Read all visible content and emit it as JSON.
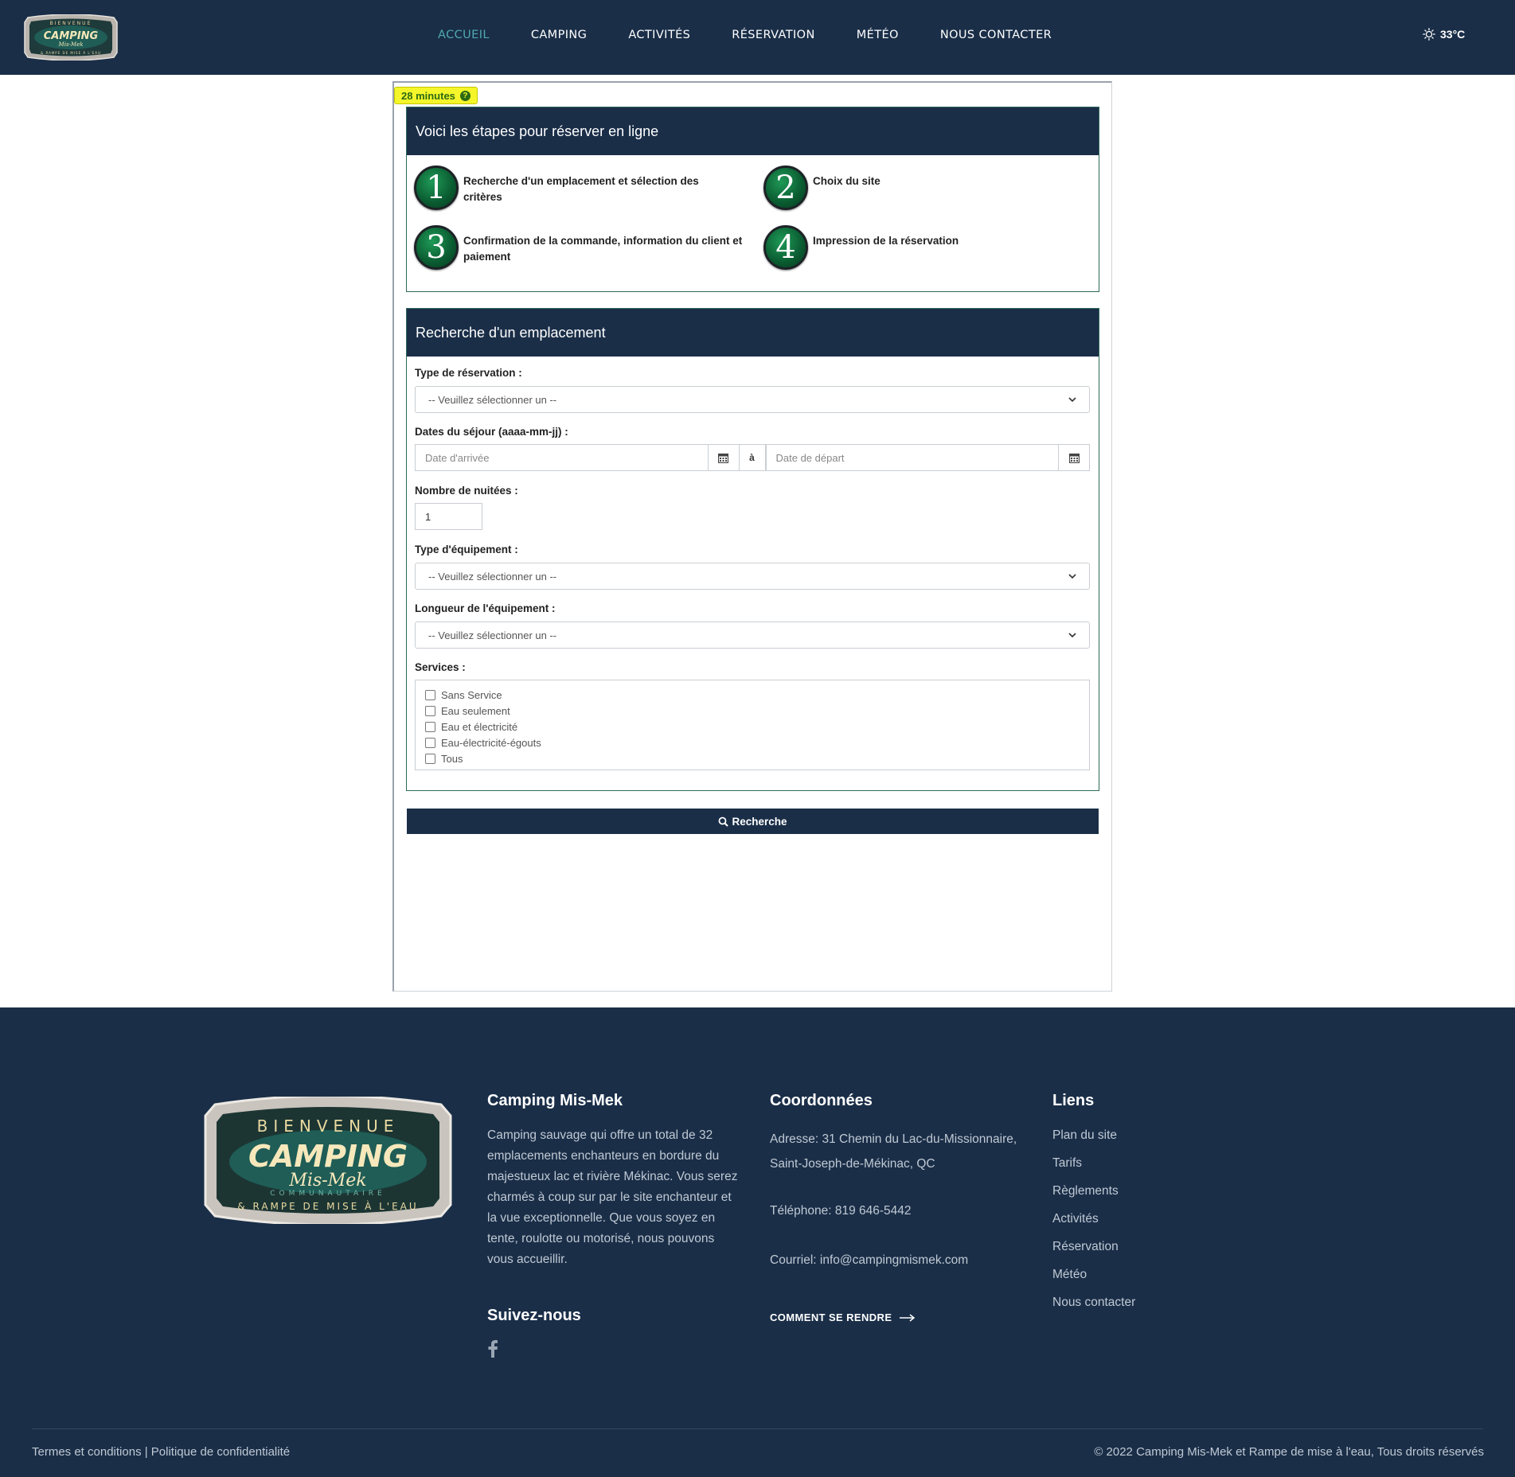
{
  "header": {
    "logo": {
      "top": "BIENVENUE",
      "main": "CAMPING",
      "script": "Mis-Mek",
      "sub": "& RAMPE DE MISE À L'EAU"
    },
    "nav": [
      "ACCUEIL",
      "CAMPING",
      "ACTIVITÉS",
      "RÉSERVATION",
      "MÉTÉO",
      "NOUS CONTACTER"
    ],
    "active_nav": "ACCUEIL",
    "weather": {
      "icon": "sun-icon",
      "temp": "33°C"
    }
  },
  "timer": {
    "label": "28 minutes",
    "icon": "question-circle-icon"
  },
  "steps_panel": {
    "title": "Voici les étapes pour réserver en ligne",
    "steps": [
      {
        "num": "1",
        "text": "Recherche d'un emplacement et sélection des critères"
      },
      {
        "num": "2",
        "text": "Choix du site"
      },
      {
        "num": "3",
        "text": "Confirmation de la commande, information du client et paiement"
      },
      {
        "num": "4",
        "text": "Impression de la réservation"
      }
    ]
  },
  "search_panel": {
    "title": "Recherche d'un emplacement",
    "type_reservation": {
      "label": "Type de réservation :",
      "value": "-- Veuillez sélectionner un --"
    },
    "dates": {
      "label": "Dates du séjour (aaaa-mm-jj) :",
      "arrival_placeholder": "Date d'arrivée",
      "separator": "à",
      "departure_placeholder": "Date de départ"
    },
    "nuitees": {
      "label": "Nombre de nuitées :",
      "value": "1"
    },
    "equipement": {
      "label": "Type d'équipement :",
      "value": "-- Veuillez sélectionner un --"
    },
    "longueur": {
      "label": "Longueur de l'équipement :",
      "value": "-- Veuillez sélectionner un --"
    },
    "services": {
      "label": "Services :",
      "options": [
        "Sans Service",
        "Eau seulement",
        "Eau et électricité",
        "Eau-électricité-égouts",
        "Tous"
      ]
    }
  },
  "search_button": {
    "label": "Recherche",
    "icon": "search-icon"
  },
  "footer": {
    "about": {
      "title": "Camping Mis-Mek",
      "text": "Camping sauvage qui offre un total de 32 emplacements enchanteurs en bordure du majestueux lac et rivière Mékinac. Vous serez charmés à coup sur par le site enchanteur et la vue exceptionnelle. Que vous soyez en tente, roulotte ou motorisé, nous pouvons vous accueillir."
    },
    "follow": {
      "title": "Suivez-nous",
      "icon": "facebook-icon"
    },
    "contact": {
      "title": "Coordonnées",
      "address": "Adresse: 31 Chemin du Lac-du-Missionnaire, Saint-Joseph-de-Mékinac, QC",
      "phone": "Téléphone: 819 646-5442",
      "email": "Courriel: info@campingmismek.com",
      "directions": "COMMENT SE RENDRE"
    },
    "links": {
      "title": "Liens",
      "items": [
        "Plan du site",
        "Tarifs",
        "Règlements",
        "Activités",
        "Réservation",
        "Météo",
        "Nous contacter"
      ]
    },
    "logo": {
      "top": "BIENVENUE",
      "main": "CAMPING",
      "script": "Mis-Mek",
      "sub1": "COMMUNAUTAIRE",
      "sub2": "& RAMPE DE MISE À L'EAU"
    },
    "bottom_left": "Termes et conditions | Politique de confidentialité",
    "bottom_right": "© 2022 Camping Mis-Mek et Rampe de mise à l'eau, Tous droits réservés"
  },
  "colors": {
    "navy": "#1a2e48",
    "active_nav": "#4fa8b0",
    "timer_bg": "#f4f62b",
    "step_green": "#0a5a30"
  }
}
